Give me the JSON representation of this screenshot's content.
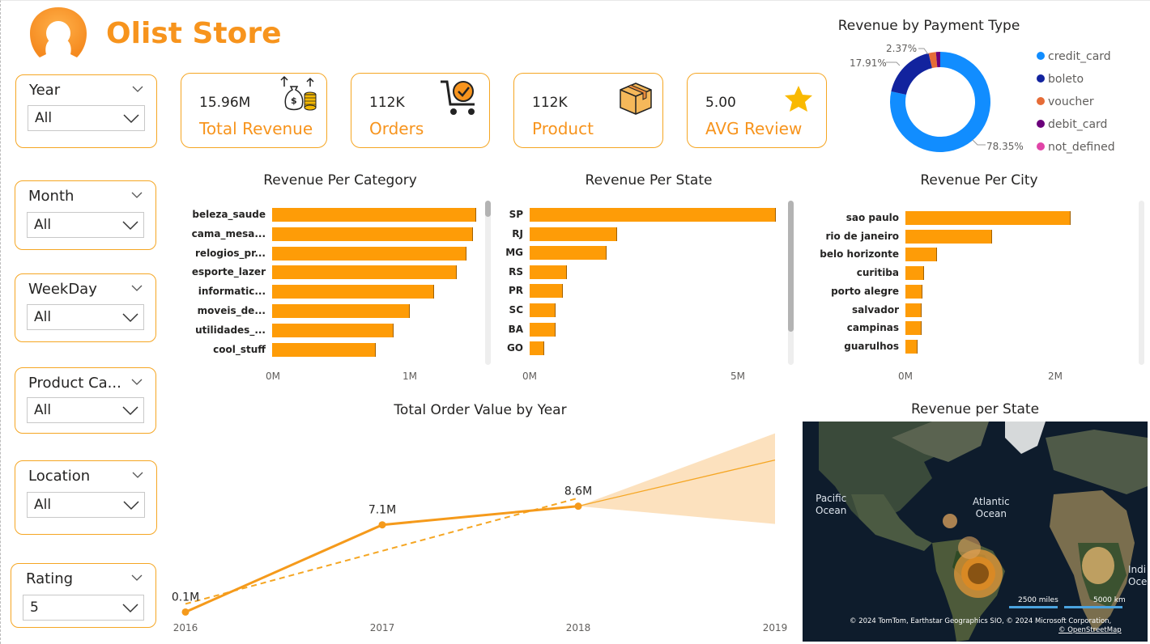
{
  "brand": {
    "name": "Olist Store",
    "color": "#f7941d"
  },
  "slicers": [
    {
      "title": "Year",
      "value": "All"
    },
    {
      "title": "Month",
      "value": "All"
    },
    {
      "title": "WeekDay",
      "value": "All"
    },
    {
      "title": "Product Ca...",
      "value": "All"
    },
    {
      "title": "Location",
      "value": "All"
    },
    {
      "title": "Rating",
      "value": "5"
    }
  ],
  "kpis": [
    {
      "value": "15.96M",
      "label": "Total Revenue",
      "icon": "money-bag-icon"
    },
    {
      "value": "112K",
      "label": "Orders",
      "icon": "shopping-cart-icon"
    },
    {
      "value": "112K",
      "label": "Product",
      "icon": "box-icon"
    },
    {
      "value": "5.00",
      "label": "AVG Review",
      "icon": "star-icon"
    }
  ],
  "payment": {
    "title": "Revenue by Payment Type",
    "labels": {
      "credit_card": "78.35%",
      "boleto": "17.91%",
      "voucher": "2.37%"
    },
    "chart_data": {
      "type": "pie",
      "categories": [
        "credit_card",
        "boleto",
        "voucher",
        "debit_card",
        "not_defined"
      ],
      "values": [
        78.35,
        17.91,
        2.37,
        1.37,
        0.0
      ],
      "colors": [
        "#118dff",
        "#12239e",
        "#e66c37",
        "#6b007b",
        "#e044a7"
      ]
    }
  },
  "category": {
    "title": "Revenue Per Category",
    "axis": [
      "0M",
      "1M"
    ],
    "chart_data": {
      "type": "bar",
      "categories": [
        "beleza_saude",
        "cama_mesa...",
        "relogios_pr...",
        "esporte_lazer",
        "informatic...",
        "moveis_de...",
        "utilidades_...",
        "cool_stuff"
      ],
      "values": [
        1.26,
        1.24,
        1.2,
        1.14,
        1.0,
        0.85,
        0.75,
        0.64
      ],
      "xlim": [
        0,
        1.63
      ]
    }
  },
  "state": {
    "title": "Revenue Per State",
    "axis": [
      "0M",
      "5M"
    ],
    "chart_data": {
      "type": "bar",
      "categories": [
        "SP",
        "RJ",
        "MG",
        "RS",
        "PR",
        "SC",
        "BA",
        "GO"
      ],
      "values": [
        5.9,
        2.1,
        1.85,
        0.89,
        0.8,
        0.62,
        0.62,
        0.35
      ],
      "xlim": [
        0,
        5.9
      ]
    }
  },
  "city": {
    "title": "Revenue Per City",
    "axis": [
      "0M",
      "2M"
    ],
    "chart_data": {
      "type": "bar",
      "categories": [
        "sao paulo",
        "rio de janeiro",
        "belo horizonte",
        "curitiba",
        "porto alegre",
        "salvador",
        "campinas",
        "guarulhos"
      ],
      "values": [
        2.2,
        1.16,
        0.42,
        0.25,
        0.23,
        0.22,
        0.22,
        0.16
      ],
      "xlim": [
        0,
        2.0
      ]
    }
  },
  "order_value": {
    "title": "Total Order Value by Year",
    "chart_data": {
      "type": "line",
      "x": [
        "2016",
        "2017",
        "2018",
        "2019"
      ],
      "series": [
        {
          "values": [
            0.1,
            7.1,
            8.6,
            null
          ],
          "labels": [
            "0.1M",
            "7.1M",
            "8.6M",
            ""
          ]
        }
      ],
      "trend": "dashed"
    }
  },
  "map": {
    "title": "Revenue per State",
    "labels": {
      "pacific": "Pacific\nOcean",
      "atlantic": "Atlantic\nOcean",
      "indian": "Indi\nOce"
    },
    "scale": [
      "2500 miles",
      "5000 km"
    ],
    "copyright": "© 2024 TomTom, Earthstar Geographics SIO, © 2024 Microsoft Corporation,",
    "osm": "© OpenStreetMap"
  }
}
